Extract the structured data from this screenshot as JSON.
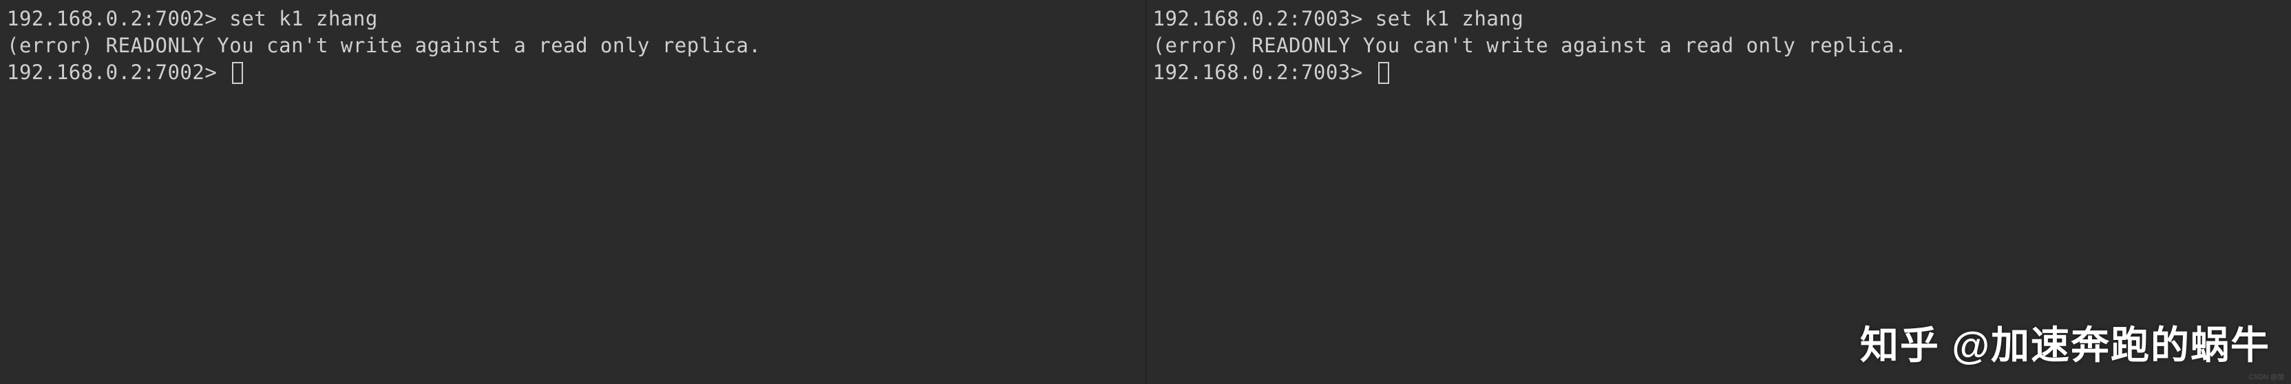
{
  "left_terminal": {
    "prompt1": "192.168.0.2:7002>",
    "command1": "set k1 zhang",
    "error": "(error) READONLY You can't write against a read only replica.",
    "prompt2": "192.168.0.2:7002>"
  },
  "right_terminal": {
    "prompt1": "192.168.0.2:7003>",
    "command1": "set k1 zhang",
    "error": "(error) READONLY You can't write against a read only replica.",
    "prompt2": "192.168.0.2:7003>"
  },
  "watermark": "知乎 @加速奔跑的蜗牛",
  "tiny_mark": "CSDN @加"
}
